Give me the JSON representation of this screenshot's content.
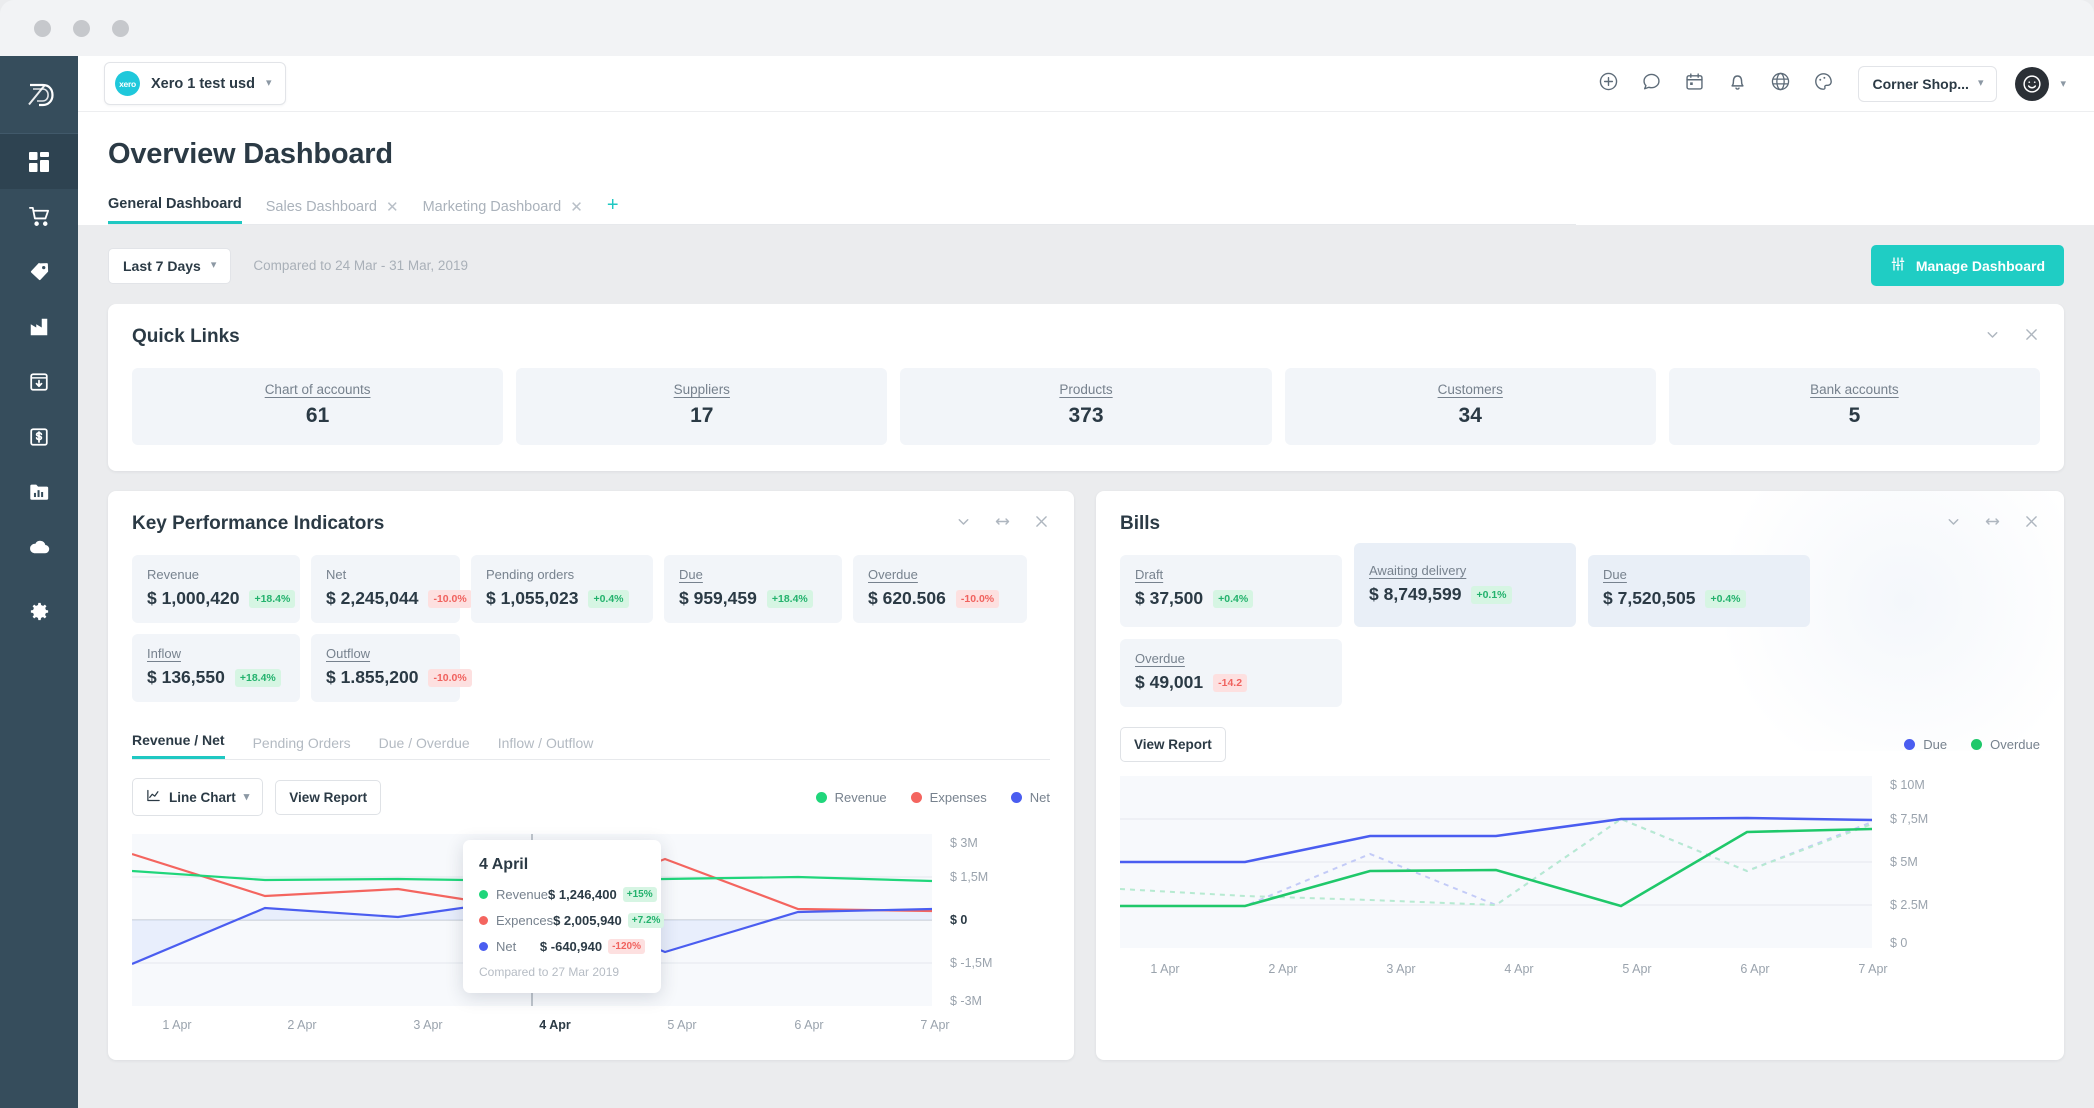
{
  "window": {
    "traffic_lights": [
      "close",
      "minimize",
      "maximize"
    ]
  },
  "sidebar": {
    "logo": "app-logo",
    "items": [
      {
        "name": "dashboard",
        "icon": "grid-icon",
        "active": true
      },
      {
        "name": "purchases",
        "icon": "cart-icon",
        "active": false
      },
      {
        "name": "sales",
        "icon": "tag-icon",
        "active": false
      },
      {
        "name": "inventory",
        "icon": "factory-icon",
        "active": false
      },
      {
        "name": "receiving",
        "icon": "inbox-download-icon",
        "active": false
      },
      {
        "name": "finance",
        "icon": "dollar-box-icon",
        "active": false
      },
      {
        "name": "reports",
        "icon": "bar-chart-folder-icon",
        "active": false
      },
      {
        "name": "cloud",
        "icon": "cloud-icon",
        "active": false
      },
      {
        "name": "settings",
        "icon": "gear-icon",
        "active": false
      }
    ]
  },
  "topbar": {
    "org": {
      "name": "Xero 1 test usd",
      "logo_text": "xero"
    },
    "icons": [
      "plus-circle-icon",
      "chat-bubble-icon",
      "calendar-icon",
      "bell-icon",
      "globe-icon",
      "palette-icon"
    ],
    "company": "Corner Shop...",
    "avatar": "smiley-avatar"
  },
  "page": {
    "title": "Overview Dashboard",
    "tabs": [
      {
        "label": "General Dashboard",
        "active": true,
        "closable": false
      },
      {
        "label": "Sales Dashboard",
        "active": false,
        "closable": true
      },
      {
        "label": "Marketing Dashboard",
        "active": false,
        "closable": true
      }
    ],
    "add_tab": "+"
  },
  "filters": {
    "range": "Last 7 Days",
    "compare": "Compared to 24 Mar - 31 Mar, 2019",
    "manage_button": "Manage Dashboard"
  },
  "quick_links": {
    "title": "Quick Links",
    "items": [
      {
        "label": "Chart of accounts",
        "value": "61"
      },
      {
        "label": "Suppliers",
        "value": "17"
      },
      {
        "label": "Products",
        "value": "373"
      },
      {
        "label": "Customers",
        "value": "34"
      },
      {
        "label": "Bank accounts",
        "value": "5"
      }
    ]
  },
  "kpi_panel": {
    "title": "Key Performance Indicators",
    "metrics": [
      {
        "label": "Revenue",
        "value": "$ 1,000,420",
        "delta": "+18.4%",
        "dir": "up",
        "underline": false
      },
      {
        "label": "Net",
        "value": "$ 2,245,044",
        "delta": "-10.0%",
        "dir": "down",
        "underline": false
      },
      {
        "label": "Pending orders",
        "value": "$ 1,055,023",
        "delta": "+0.4%",
        "dir": "up",
        "underline": false
      },
      {
        "label": "Due",
        "value": "$ 959,459",
        "delta": "+18.4%",
        "dir": "up",
        "underline": true
      },
      {
        "label": "Overdue",
        "value": "$ 620.506",
        "delta": "-10.0%",
        "dir": "down",
        "underline": true
      },
      {
        "label": "Inflow",
        "value": "$ 136,550",
        "delta": "+18.4%",
        "dir": "up",
        "underline": true
      },
      {
        "label": "Outflow",
        "value": "$ 1.855,200",
        "delta": "-10.0%",
        "dir": "down",
        "underline": true
      }
    ],
    "subtabs": [
      {
        "label": "Revenue / Net",
        "active": true
      },
      {
        "label": "Pending Orders",
        "active": false
      },
      {
        "label": "Due / Overdue",
        "active": false
      },
      {
        "label": "Inflow / Outflow",
        "active": false
      }
    ],
    "chart_type": "Line Chart",
    "view_report": "View Report",
    "legend": [
      {
        "label": "Revenue",
        "color": "#20d67b"
      },
      {
        "label": "Expenses",
        "color": "#f4655f"
      },
      {
        "label": "Net",
        "color": "#4a5df0"
      }
    ],
    "tooltip": {
      "title": "4 April",
      "rows": [
        {
          "name": "Revenue",
          "color": "#20d67b",
          "value": "$ 1,246,400",
          "delta": "+15%",
          "dir": "up"
        },
        {
          "name": "Expences",
          "color": "#f4655f",
          "value": "$ 2,005,940",
          "delta": "+7.2%",
          "dir": "up"
        },
        {
          "name": "Net",
          "color": "#4a5df0",
          "value": "$ -640,940",
          "delta": "-120%",
          "dir": "down"
        }
      ],
      "footer": "Compared to 27 Mar 2019"
    }
  },
  "bills_panel": {
    "title": "Bills",
    "metrics": [
      {
        "label": "Draft",
        "value": "$ 37,500",
        "delta": "+0.4%",
        "dir": "up",
        "highlight": false
      },
      {
        "label": "Awaiting delivery",
        "value": "$ 8,749,599",
        "delta": "+0.1%",
        "dir": "up",
        "highlight": true
      },
      {
        "label": "Due",
        "value": "$ 7,520,505",
        "delta": "+0.4%",
        "dir": "up",
        "highlight": false
      },
      {
        "label": "Overdue",
        "value": "$ 49,001",
        "delta": "-14.2",
        "dir": "down",
        "highlight": false
      }
    ],
    "view_report": "View Report",
    "legend": [
      {
        "label": "Due",
        "color": "#4a5df0"
      },
      {
        "label": "Overdue",
        "color": "#1fc86a"
      }
    ]
  },
  "chart_data": [
    {
      "id": "kpi-revenue-net",
      "type": "line",
      "title": "Revenue / Net",
      "xlabel": "",
      "ylabel": "",
      "x": [
        "1 Apr",
        "2 Apr",
        "3 Apr",
        "4 Apr",
        "5 Apr",
        "6 Apr",
        "7 Apr"
      ],
      "highlight_x": "4 Apr",
      "ytick_labels": [
        "$ 3M",
        "$ 1,5M",
        "$ 0",
        "$ -1,5M",
        "$ -3M"
      ],
      "ytick_values": [
        3000000,
        1500000,
        0,
        -1500000,
        -3000000
      ],
      "ylim": [
        -3000000,
        3000000
      ],
      "grid": true,
      "legend_position": "top-right",
      "series": [
        {
          "name": "Revenue",
          "color": "#20d67b",
          "values": [
            1700000,
            1246400,
            1300000,
            1180000,
            1250000,
            1300000,
            1150000
          ]
        },
        {
          "name": "Expenses",
          "color": "#f4655f",
          "values": [
            2300000,
            820000,
            1000000,
            360000,
            2005940,
            380000,
            330000
          ]
        },
        {
          "name": "Net",
          "color": "#4a5df0",
          "values": [
            -1550000,
            240000,
            60000,
            440000,
            -640940,
            300000,
            330000
          ]
        }
      ]
    },
    {
      "id": "bills-due-overdue",
      "type": "line",
      "title": "Bills",
      "xlabel": "",
      "ylabel": "",
      "x": [
        "1 Apr",
        "2 Apr",
        "3 Apr",
        "4 Apr",
        "5 Apr",
        "6 Apr",
        "7 Apr"
      ],
      "ytick_labels": [
        "$ 10M",
        "$ 7,5M",
        "$ 5M",
        "$ 2.5M",
        "$ 0"
      ],
      "ytick_values": [
        10000000,
        7500000,
        5000000,
        2500000,
        0
      ],
      "ylim": [
        0,
        10000000
      ],
      "grid": true,
      "legend_position": "top-right",
      "series": [
        {
          "name": "Due",
          "color": "#4a5df0",
          "style": "solid",
          "values": [
            5000000,
            6000000,
            6000000,
            4500000,
            8100000,
            8400000,
            8000000
          ]
        },
        {
          "name": "Overdue",
          "color": "#1fc86a",
          "style": "solid",
          "values": [
            2500000,
            5200000,
            5300000,
            2900000,
            7300000,
            7600000,
            7300000
          ]
        },
        {
          "name": "Due previous",
          "color": "#c3cbf7",
          "style": "dotted",
          "values": [
            2400000,
            3200000,
            7000000,
            2800000,
            8700000,
            4700000,
            8000000
          ]
        },
        {
          "name": "Overdue previous",
          "color": "#b6ead1",
          "style": "dotted",
          "values": [
            3400000,
            3000000,
            2700000,
            2900000,
            8700000,
            4800000,
            7800000
          ]
        }
      ]
    }
  ]
}
